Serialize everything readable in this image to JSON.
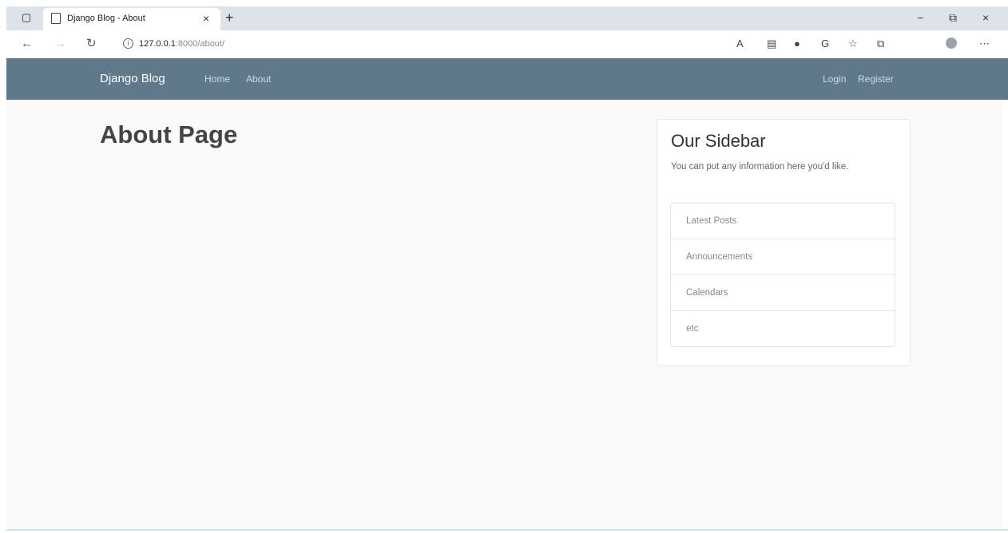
{
  "browser": {
    "tab_title": "Django Blog - About",
    "url_host": "127.0.0.1",
    "url_rest": ":8000/about/",
    "icons": {
      "window": "window-icon",
      "page": "page-icon",
      "close_tab": "close-icon",
      "new_tab": "plus-icon",
      "back": "back-arrow-icon",
      "forward": "forward-arrow-icon",
      "refresh": "refresh-icon",
      "info": "info-icon",
      "read_aloud": "read-aloud-icon",
      "reading_view": "reading-view-icon",
      "extension": "extension-icon",
      "shield": "shield-icon",
      "favorites": "star-icon",
      "collections": "collections-icon",
      "profile": "avatar",
      "menu": "more-icon"
    },
    "window_controls": {
      "minimize": "−",
      "restore": "⧉",
      "close": "×"
    }
  },
  "navbar": {
    "brand": "Django Blog",
    "links": [
      "Home",
      "About"
    ],
    "auth": [
      "Login",
      "Register"
    ],
    "color": "#5f788a"
  },
  "main": {
    "title": "About Page"
  },
  "sidebar": {
    "title": "Our Sidebar",
    "description": "You can put any information here you'd like.",
    "items": [
      "Latest Posts",
      "Announcements",
      "Calendars",
      "etc"
    ]
  }
}
